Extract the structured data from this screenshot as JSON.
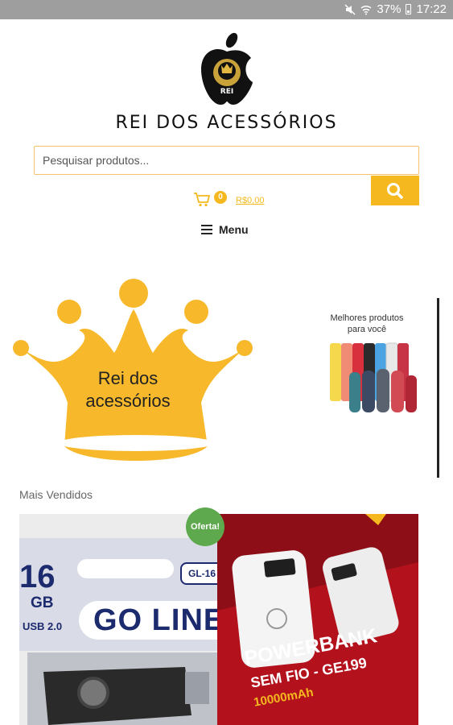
{
  "status_bar": {
    "battery": "37%",
    "time": "17:22"
  },
  "header": {
    "logo_text": "REI",
    "title": "REI DOS ACESSÓRIOS"
  },
  "search": {
    "placeholder": "Pesquisar produtos..."
  },
  "cart": {
    "count": "0",
    "total": "R$0,00"
  },
  "menu": {
    "label": "Menu"
  },
  "banner_crown": {
    "line1": "Rei dos",
    "line2": "acessórios"
  },
  "banner_promo": {
    "line1": "Melhores produtos",
    "line2": "para você"
  },
  "section": {
    "title": "Mais Vendidos"
  },
  "products": [
    {
      "badge": "Oferta!",
      "size": "16",
      "unit": "GB",
      "standard": "USB 2.0",
      "model": "GL-16",
      "brand": "GO LINE"
    },
    {
      "title": "POWERBANK",
      "subtitle": "SEM FIO - GE199",
      "capacity": "10000mAh"
    }
  ],
  "colors": {
    "accent": "#f5b91f",
    "status_bar": "#9e9e9e",
    "offer": "#5ea94d",
    "powerbank_bg": "#b3121d"
  }
}
